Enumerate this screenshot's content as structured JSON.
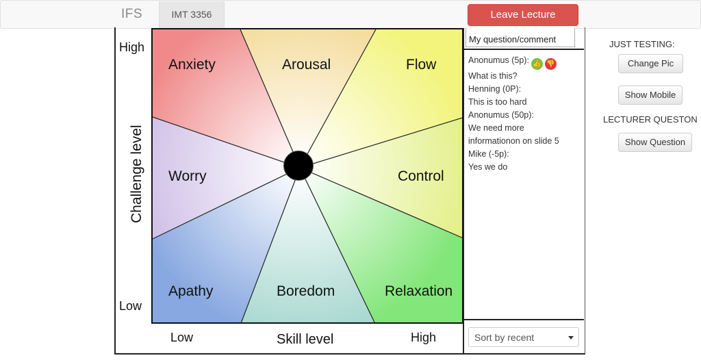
{
  "navbar": {
    "brand": "IFS",
    "course_tab": "IMT 3356",
    "leave_button": "Leave Lecture",
    "leave_color": "#d9534f"
  },
  "diagram": {
    "y_axis_title": "Challenge level",
    "x_axis_title": "Skill level",
    "y_high": "High",
    "y_low": "Low",
    "x_low": "Low",
    "x_high": "High",
    "zones": {
      "anxiety": "Anxiety",
      "arousal": "Arousal",
      "flow": "Flow",
      "worry": "Worry",
      "control": "Control",
      "apathy": "Apathy",
      "boredom": "Boredom",
      "relaxation": "Relaxation"
    },
    "zone_colors": {
      "anxiety": "#f08a8a",
      "arousal": "#f3d891",
      "flow": "#f2f47c",
      "worry": "#cdbde6",
      "control": "#e3f08a",
      "apathy": "#87a8e0",
      "boredom": "#a7d8cf",
      "relaxation": "#83e67a"
    }
  },
  "comments_panel": {
    "input_value": "My question/comment",
    "comments": [
      "Anonumus (5p):",
      "What is this?",
      "Henning (0P):",
      "This is too hard",
      "Anonumus (50p):",
      "We need more",
      "informationon on slide 5",
      "Mike (-5p):",
      "Yes we do"
    ],
    "vote_up_icon": "thumbs-up-icon",
    "vote_down_icon": "thumbs-down-icon",
    "sort_selected": "Sort by recent"
  },
  "side": {
    "testing_label": "JUST TESTING:",
    "change_pic": "Change Pic",
    "show_mobile": "Show Mobile",
    "lecturer_label": "LECTURER QUESTON",
    "show_question": "Show Question"
  }
}
